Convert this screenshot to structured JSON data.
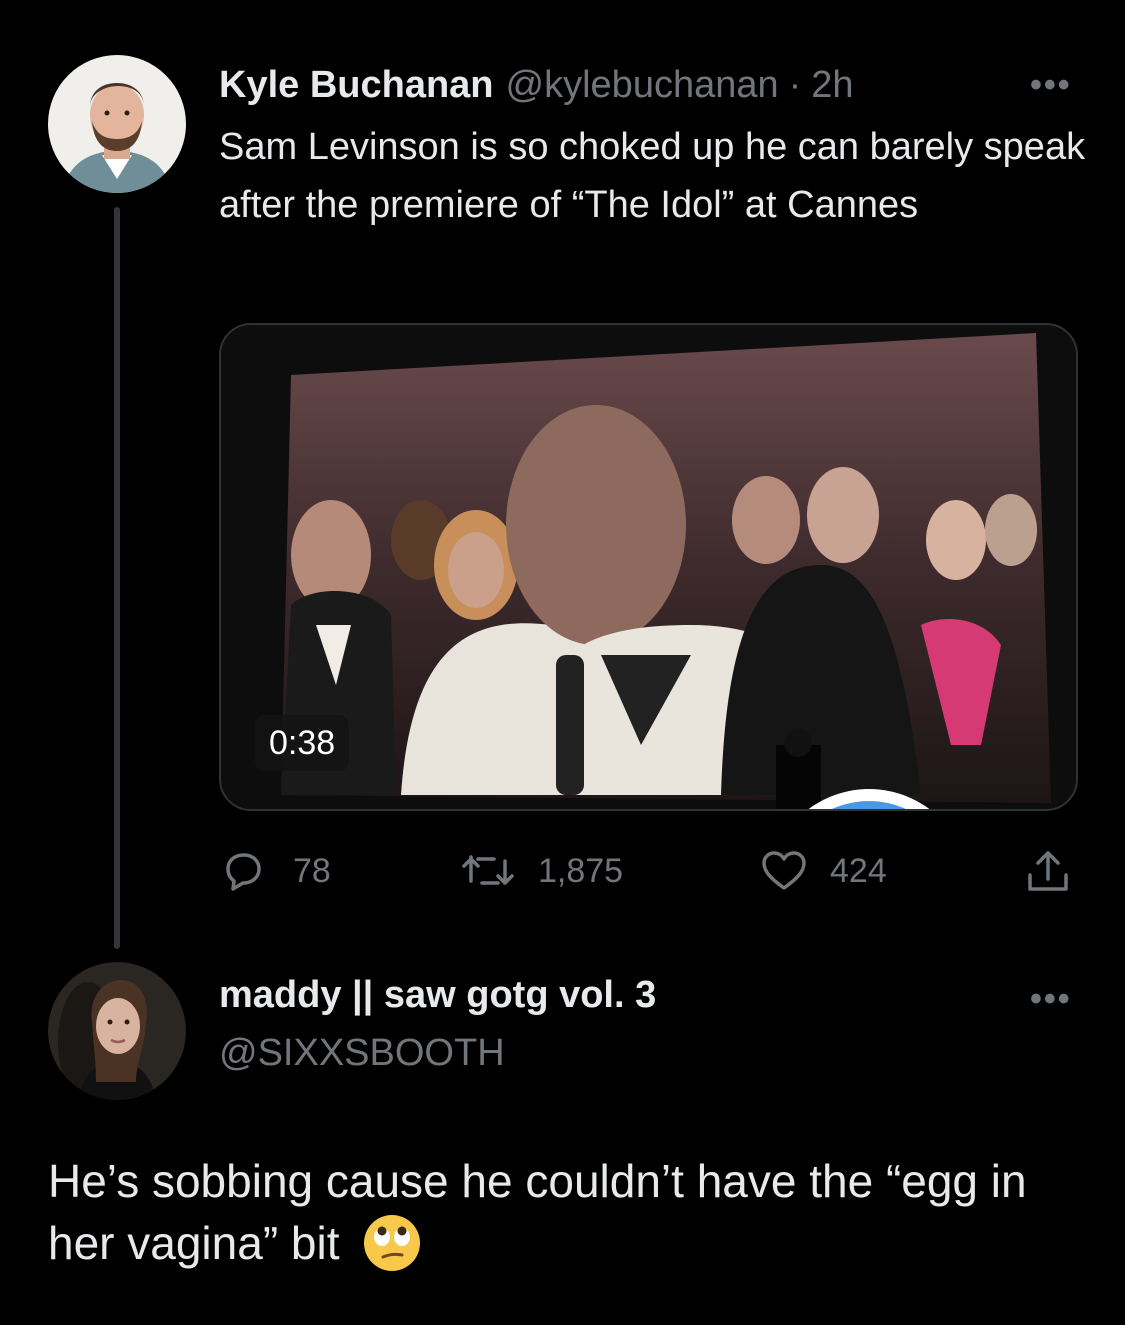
{
  "tweet": {
    "author_name": "Kyle Buchanan",
    "author_handle": "@kylebuchanan",
    "separator": "·",
    "time": "2h",
    "text": "Sam Levinson is so choked up he can barely speak after the premiere of “The Idol” at Cannes",
    "more_label": "•••",
    "video": {
      "duration": "0:38"
    },
    "stats": {
      "replies": "78",
      "retweets": "1,875",
      "likes": "424"
    }
  },
  "reply": {
    "author_name": "maddy || saw gotg vol. 3",
    "author_handle": "@SIXXSBOOTH",
    "more_label": "•••",
    "text": "He’s sobbing cause he couldn’t have the “egg in her vagina” bit",
    "emoji": "face-with-rolling-eyes"
  },
  "colors": {
    "background": "#000000",
    "text": "#e7e9ea",
    "muted": "#71767b",
    "play_button": "#4a98e5"
  },
  "icons": [
    "reply-icon",
    "retweet-icon",
    "like-icon",
    "share-icon",
    "play-icon",
    "more-icon"
  ]
}
